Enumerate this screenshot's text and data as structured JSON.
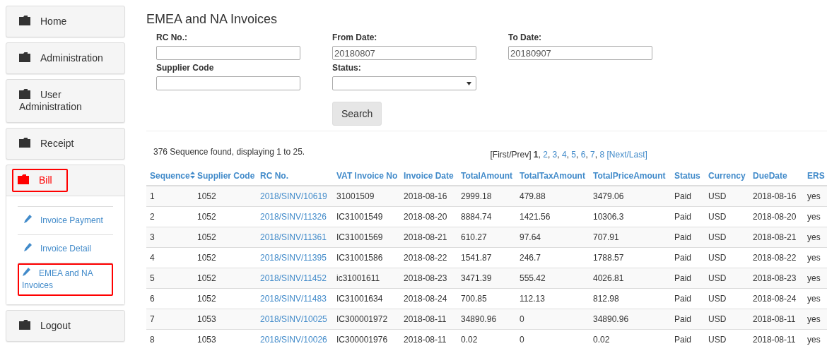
{
  "sidebar": {
    "items": [
      {
        "label": "Home",
        "selected": false,
        "highlighted": false
      },
      {
        "label": "Administration",
        "selected": false,
        "highlighted": false
      },
      {
        "label": "User Administration",
        "selected": false,
        "highlighted": false
      },
      {
        "label": "Receipt",
        "selected": false,
        "highlighted": false
      },
      {
        "label": "Bill",
        "selected": true,
        "highlighted": true,
        "children": [
          {
            "label": "Invoice Payment",
            "highlighted": false
          },
          {
            "label": "Invoice Detail",
            "highlighted": false
          },
          {
            "label": "EMEA and NA Invoices",
            "highlighted": true
          }
        ]
      },
      {
        "label": "Logout",
        "selected": false,
        "highlighted": false
      }
    ]
  },
  "page": {
    "title": "EMEA and NA Invoices"
  },
  "form": {
    "fields": [
      {
        "label": "RC No.:",
        "kind": "text"
      },
      {
        "label": "From Date:",
        "kind": "text",
        "value": "20180807"
      },
      {
        "label": "To Date:",
        "kind": "text",
        "value": "20180907"
      },
      {
        "label": "Supplier Code",
        "kind": "text"
      },
      {
        "label": "Status:",
        "kind": "select"
      }
    ],
    "button": "Search"
  },
  "results": {
    "summary": "376 Sequence found, displaying 1 to 25.",
    "pagination": {
      "prev": "[First/Prev]",
      "pages": [
        {
          "label": "1",
          "selected": true,
          "separator": ","
        },
        {
          "label": "2",
          "selected": false,
          "separator": ","
        },
        {
          "label": "3",
          "selected": false,
          "separator": ","
        },
        {
          "label": "4",
          "selected": false,
          "separator": ","
        },
        {
          "label": "5",
          "selected": false,
          "separator": ","
        },
        {
          "label": "6",
          "selected": false,
          "separator": ","
        },
        {
          "label": "7",
          "selected": false,
          "separator": ","
        },
        {
          "label": "8",
          "selected": false
        }
      ],
      "next": "[Next/Last]"
    }
  },
  "table": {
    "columns": [
      {
        "label": "Sequence",
        "sortable": true
      },
      {
        "label": "Supplier Code",
        "sortable": false
      },
      {
        "label": "RC No.",
        "sortable": false
      },
      {
        "label": "VAT Invoice No",
        "sortable": false
      },
      {
        "label": "Invoice Date",
        "sortable": false
      },
      {
        "label": "TotalAmount",
        "sortable": false
      },
      {
        "label": "TotalTaxAmount",
        "sortable": false
      },
      {
        "label": "TotalPriceAmount",
        "sortable": false
      },
      {
        "label": "Status",
        "sortable": false
      },
      {
        "label": "Currency",
        "sortable": false
      },
      {
        "label": "DueDate",
        "sortable": false
      },
      {
        "label": "ERS",
        "sortable": false
      }
    ],
    "rows": [
      [
        "1",
        "1052",
        "2018/SINV/10619",
        "31001509",
        "2018-08-16",
        "2999.18",
        "479.88",
        "3479.06",
        "Paid",
        "USD",
        "2018-08-16",
        "yes"
      ],
      [
        "2",
        "1052",
        "2018/SINV/11326",
        "IC31001549",
        "2018-08-20",
        "8884.74",
        "1421.56",
        "10306.3",
        "Paid",
        "USD",
        "2018-08-20",
        "yes"
      ],
      [
        "3",
        "1052",
        "2018/SINV/11361",
        "IC31001569",
        "2018-08-21",
        "610.27",
        "97.64",
        "707.91",
        "Paid",
        "USD",
        "2018-08-21",
        "yes"
      ],
      [
        "4",
        "1052",
        "2018/SINV/11395",
        "IC31001586",
        "2018-08-22",
        "1541.87",
        "246.7",
        "1788.57",
        "Paid",
        "USD",
        "2018-08-22",
        "yes"
      ],
      [
        "5",
        "1052",
        "2018/SINV/11452",
        "ic31001611",
        "2018-08-23",
        "3471.39",
        "555.42",
        "4026.81",
        "Paid",
        "USD",
        "2018-08-23",
        "yes"
      ],
      [
        "6",
        "1052",
        "2018/SINV/11483",
        "IC31001634",
        "2018-08-24",
        "700.85",
        "112.13",
        "812.98",
        "Paid",
        "USD",
        "2018-08-24",
        "yes"
      ],
      [
        "7",
        "1053",
        "2018/SINV/10025",
        "IC300001972",
        "2018-08-11",
        "34890.96",
        "0",
        "34890.96",
        "Paid",
        "USD",
        "2018-08-11",
        "yes"
      ],
      [
        "8",
        "1053",
        "2018/SINV/10026",
        "IC300001976",
        "2018-08-11",
        "0.02",
        "0",
        "0.02",
        "Paid",
        "USD",
        "2018-08-11",
        "yes"
      ]
    ]
  }
}
